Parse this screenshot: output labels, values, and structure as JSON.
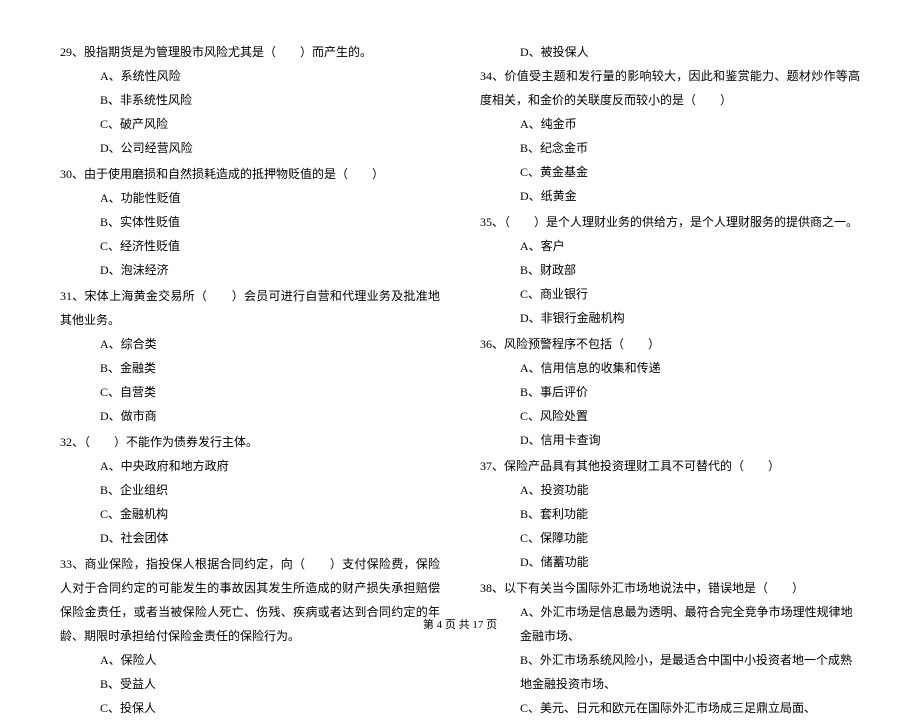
{
  "left": {
    "q29": {
      "stem": "29、股指期货是为管理股市风险尤其是（　　）而产生的。",
      "a": "A、系统性风险",
      "b": "B、非系统性风险",
      "c": "C、破产风险",
      "d": "D、公司经营风险"
    },
    "q30": {
      "stem": "30、由于使用磨损和自然损耗造成的抵押物贬值的是（　　）",
      "a": "A、功能性贬值",
      "b": "B、实体性贬值",
      "c": "C、经济性贬值",
      "d": "D、泡沫经济"
    },
    "q31": {
      "stem": "31、宋体上海黄金交易所（　　）会员可进行自营和代理业务及批准地其他业务。",
      "a": "A、综合类",
      "b": "B、金融类",
      "c": "C、自营类",
      "d": "D、做市商"
    },
    "q32": {
      "stem": "32、（　　）不能作为债券发行主体。",
      "a": "A、中央政府和地方政府",
      "b": "B、企业组织",
      "c": "C、金融机构",
      "d": "D、社会团体"
    },
    "q33": {
      "stem": "33、商业保险，指投保人根据合同约定，向（　　）支付保险费，保险人对于合同约定的可能发生的事故因其发生所造成的财产损失承担赔偿保险金责任，或者当被保险人死亡、伤残、疾病或者达到合同约定的年龄、期限时承担给付保险金责任的保险行为。",
      "a": "A、保险人",
      "b": "B、受益人",
      "c": "C、投保人"
    }
  },
  "right": {
    "q33d": "D、被投保人",
    "q34": {
      "stem": "34、价值受主题和发行量的影响较大，因此和鉴赏能力、题材炒作等高度相关，和金价的关联度反而较小的是（　　）",
      "a": "A、纯金币",
      "b": "B、纪念金币",
      "c": "C、黄金基金",
      "d": "D、纸黄金"
    },
    "q35": {
      "stem": "35、（　　）是个人理财业务的供给方，是个人理财服务的提供商之一。",
      "a": "A、客户",
      "b": "B、财政部",
      "c": "C、商业银行",
      "d": "D、非银行金融机构"
    },
    "q36": {
      "stem": "36、风险预警程序不包括（　　）",
      "a": "A、信用信息的收集和传递",
      "b": "B、事后评价",
      "c": "C、风险处置",
      "d": "D、信用卡查询"
    },
    "q37": {
      "stem": "37、保险产品具有其他投资理财工具不可替代的（　　）",
      "a": "A、投资功能",
      "b": "B、套利功能",
      "c": "C、保障功能",
      "d": "D、储蓄功能"
    },
    "q38": {
      "stem": "38、以下有关当今国际外汇市场地说法中，错误地是（　　）",
      "a": "A、外汇市场是信息最为透明、最符合完全竞争市场理性规律地金融市场、",
      "b": "B、外汇市场系统风险小，是最适合中国中小投资者地一个成熟地金融投资市场、",
      "c": "C、美元、日元和欧元在国际外汇市场成三足鼎立局面、"
    }
  },
  "footer": "第 4 页 共 17 页"
}
